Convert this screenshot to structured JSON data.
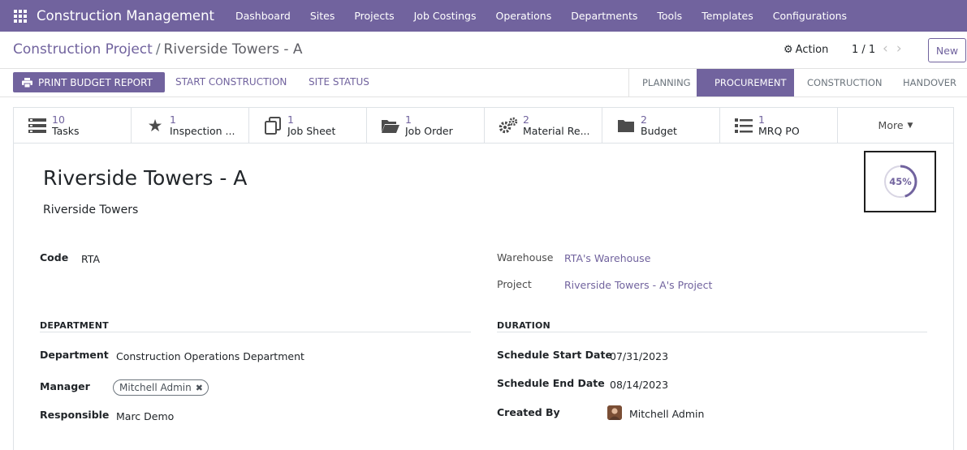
{
  "navbar": {
    "brand": "Construction Management",
    "menu": [
      "Dashboard",
      "Sites",
      "Projects",
      "Job Costings",
      "Operations",
      "Departments",
      "Tools",
      "Templates",
      "Configurations"
    ]
  },
  "breadcrumb": {
    "parent": "Construction Project",
    "separator": "/",
    "current": "Riverside Towers - A"
  },
  "control": {
    "action_label": "Action",
    "pager": "1 / 1",
    "new_label": "New"
  },
  "statusbar": {
    "print_label": "PRINT BUDGET REPORT",
    "start_label": "START CONSTRUCTION",
    "site_status_label": "SITE STATUS",
    "stages": [
      "PLANNING",
      "PROCUREMENT",
      "CONSTRUCTION",
      "HANDOVER"
    ],
    "active_stage": "PROCUREMENT"
  },
  "smart_buttons": [
    {
      "count": "10",
      "label": "Tasks",
      "icon": "tasks-icon"
    },
    {
      "count": "1",
      "label": "Inspection ...",
      "icon": "star-icon"
    },
    {
      "count": "1",
      "label": "Job Sheet",
      "icon": "copy-icon"
    },
    {
      "count": "1",
      "label": "Job Order",
      "icon": "folder-open-icon"
    },
    {
      "count": "2",
      "label": "Material Re...",
      "icon": "gears-icon"
    },
    {
      "count": "2",
      "label": "Budget",
      "icon": "folder-icon"
    },
    {
      "count": "1",
      "label": "MRQ PO",
      "icon": "list-icon"
    }
  ],
  "more_label": "More",
  "form": {
    "title": "Riverside Towers - A",
    "subtitle": "Riverside Towers",
    "progress": 45,
    "progress_label": "45%",
    "code_label": "Code",
    "code_value": "RTA",
    "warehouse_label": "Warehouse",
    "warehouse_value": "RTA's Warehouse",
    "project_label": "Project",
    "project_value": "Riverside Towers - A's Project",
    "department_group": "DEPARTMENT",
    "department_label": "Department",
    "department_value": "Construction Operations Department",
    "manager_label": "Manager",
    "manager_value": "Mitchell Admin",
    "responsible_label": "Responsible",
    "responsible_value": "Marc Demo",
    "duration_group": "DURATION",
    "start_label": "Schedule Start Date",
    "start_value": "07/31/2023",
    "end_label": "Schedule End Date",
    "end_value": "08/14/2023",
    "created_label": "Created By",
    "created_value": "Mitchell Admin"
  },
  "colors": {
    "brand": "#71639e"
  }
}
